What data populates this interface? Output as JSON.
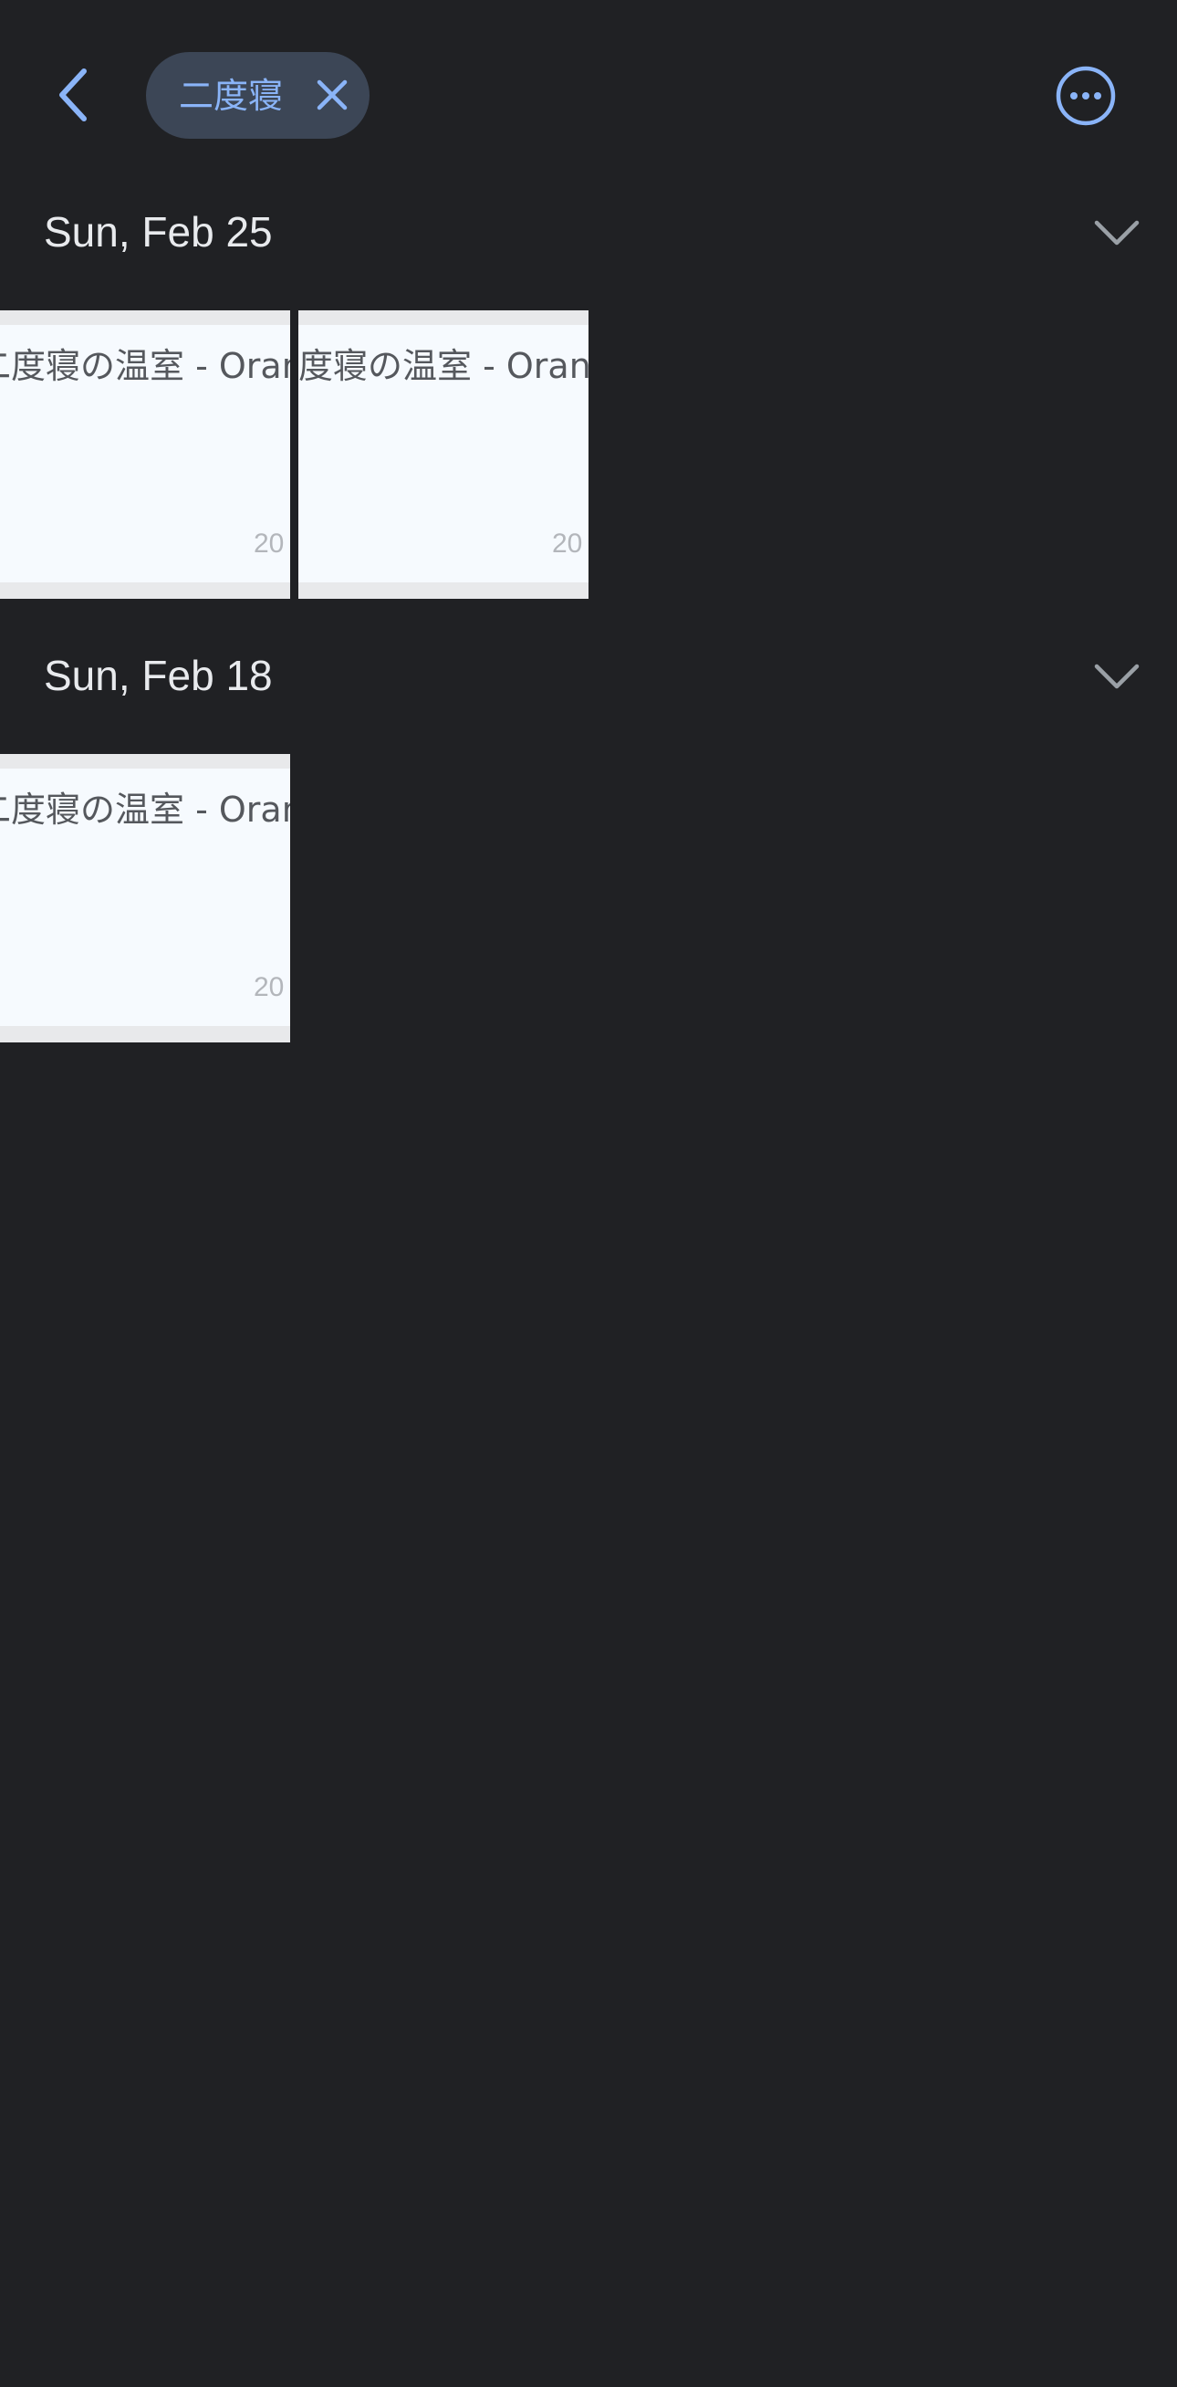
{
  "header": {
    "back_icon": "chevron-left-icon",
    "filter_chip": {
      "label": "二度寝",
      "close_icon": "close-icon"
    },
    "more_icon": "more-horizontal-circle-icon"
  },
  "sections": [
    {
      "date": "Sun, Feb 25",
      "collapse_icon": "chevron-down-icon",
      "items": [
        {
          "title": "二度寝の温室 - Orange",
          "year": "20"
        },
        {
          "title": "二度寝の温室 - Orange",
          "year": "20"
        }
      ]
    },
    {
      "date": "Sun, Feb 18",
      "collapse_icon": "chevron-down-icon",
      "items": [
        {
          "title": "二度寝の温室 - Orange",
          "year": "20"
        }
      ]
    }
  ],
  "colors": {
    "background": "#202124",
    "accent": "#8ab4f8",
    "chip_background": "#3c4656",
    "text_primary": "#e8eaed",
    "chevron": "#9aa0a6",
    "thumbnail_background": "#f6fafe"
  }
}
